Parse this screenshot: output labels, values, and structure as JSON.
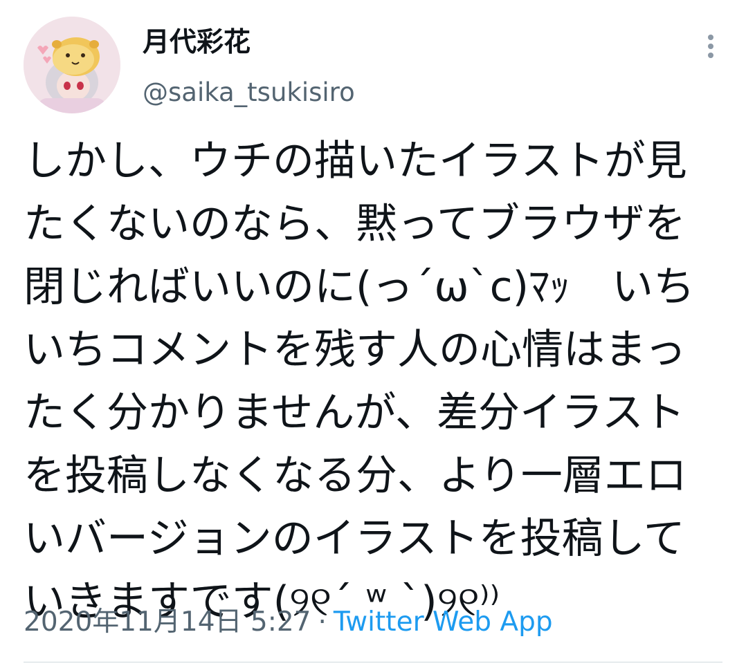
{
  "user": {
    "display_name": "月代彩花",
    "handle": "@saika_tsukisiro",
    "avatar": "avatar-illustration"
  },
  "tweet": {
    "lines": [
      "しかし、ウチの描いたイラストが見",
      "たくないのなら、黙ってブラウザを",
      "閉じればいいのに(っ´ω`c)ﾏｯ　いち",
      "いちコメントを残す人の心情はまっ",
      "たく分かりませんが、差分イラスト",
      "を投稿しなくなる分、より一層エロ",
      "いバージョンのイラストを投稿して",
      "いきますです(୨୧´ ʷ `)୨୧⁾⁾"
    ],
    "timestamp": "2020年11月14日 5:27",
    "separator": "·",
    "source": "Twitter Web App"
  },
  "icons": {
    "more": "more-vertical-icon"
  },
  "colors": {
    "text_primary": "#0f1419",
    "text_secondary": "#536471",
    "accent": "#1d9bf0",
    "divider": "#cfd9de"
  }
}
